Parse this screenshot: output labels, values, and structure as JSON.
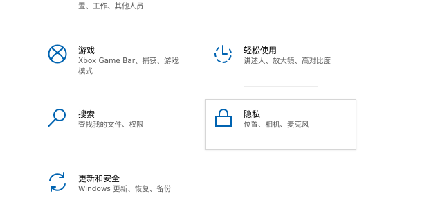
{
  "partial_top": {
    "left_desc": "置、工作、其他人员",
    "right_desc": "…… ……"
  },
  "tiles": {
    "gaming": {
      "title": "游戏",
      "desc": "Xbox Game Bar、捕获、游戏模式",
      "icon": "xbox-icon"
    },
    "ease": {
      "title": "轻松使用",
      "desc": "讲述人、放大镜、高对比度",
      "icon": "ease-of-access-icon"
    },
    "search": {
      "title": "搜索",
      "desc": "查找我的文件、权限",
      "icon": "search-icon"
    },
    "privacy": {
      "title": "隐私",
      "desc": "位置、相机、麦克风",
      "icon": "lock-icon"
    },
    "update": {
      "title": "更新和安全",
      "desc": "Windows 更新、恢复、备份",
      "icon": "sync-icon"
    }
  },
  "colors": {
    "accent": "#0063b1",
    "text": "#000000",
    "secondary_text": "#5a5a5a",
    "hover_border": "#d6d6d6"
  }
}
